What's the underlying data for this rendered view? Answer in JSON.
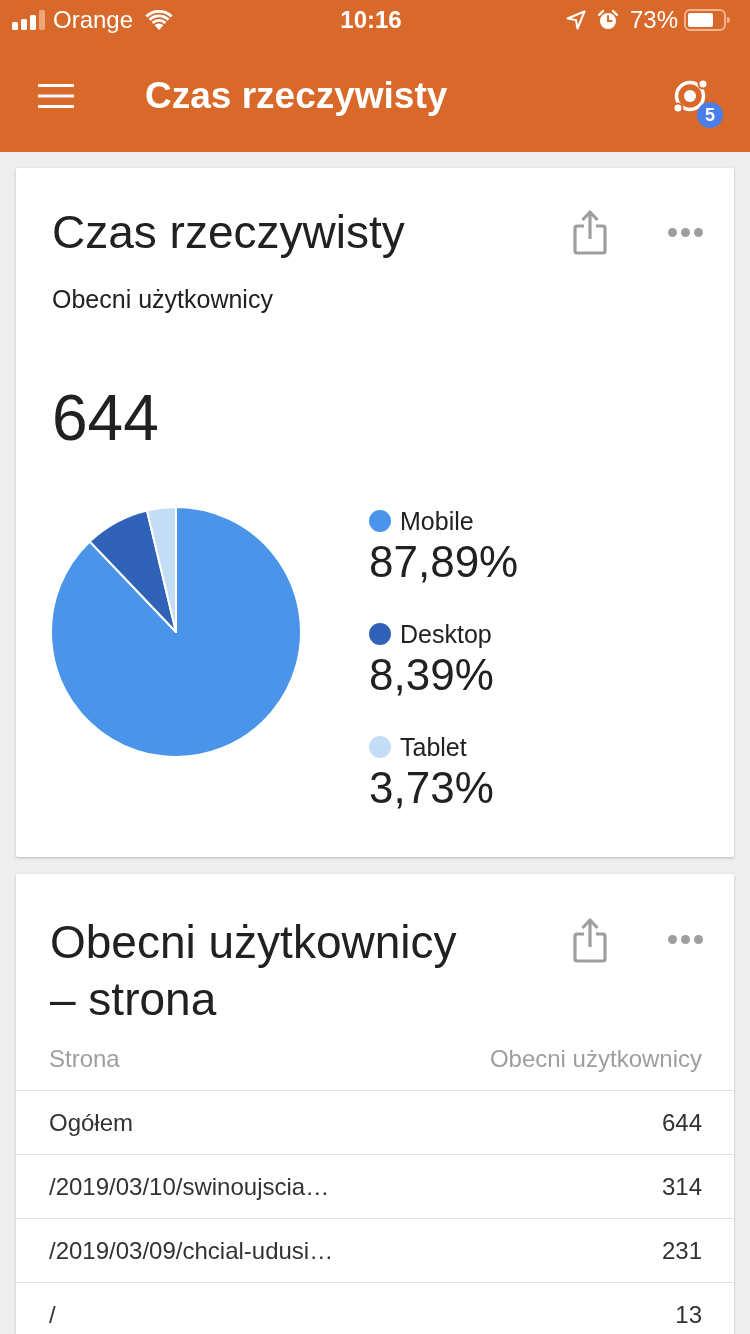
{
  "status_bar": {
    "carrier": "Orange",
    "time": "10:16",
    "battery": "73%"
  },
  "app_bar": {
    "title": "Czas rzeczywisty",
    "badge": "5"
  },
  "cards": [
    {
      "kind": "pie",
      "title": "Czas rzeczywisty",
      "subtitle": "Obecni użytkownicy",
      "total": "644",
      "legend": [
        {
          "value": "87,89%",
          "color": "#4a94ea"
        },
        {
          "value": "8,39%",
          "color": "#3063b8"
        },
        {
          "value": "3,73%",
          "color": "#c3ddf6"
        }
      ],
      "chart_data": {
        "type": "pie",
        "categories": [
          "Mobile",
          "Desktop",
          "Tablet"
        ],
        "values": [
          87.89,
          8.39,
          3.73
        ]
      }
    },
    {
      "kind": "table",
      "title": "Obecni użytkownicy – strona",
      "table": {
        "columns": [
          "Strona",
          "Obecni użytkownicy"
        ],
        "rows": [
          [
            "Ogółem",
            "644"
          ],
          [
            "/2019/03/10/swinoujscia…",
            "314"
          ],
          [
            "/2019/03/09/chcial-udusi…",
            "231"
          ],
          [
            "/",
            "13"
          ]
        ]
      }
    }
  ]
}
